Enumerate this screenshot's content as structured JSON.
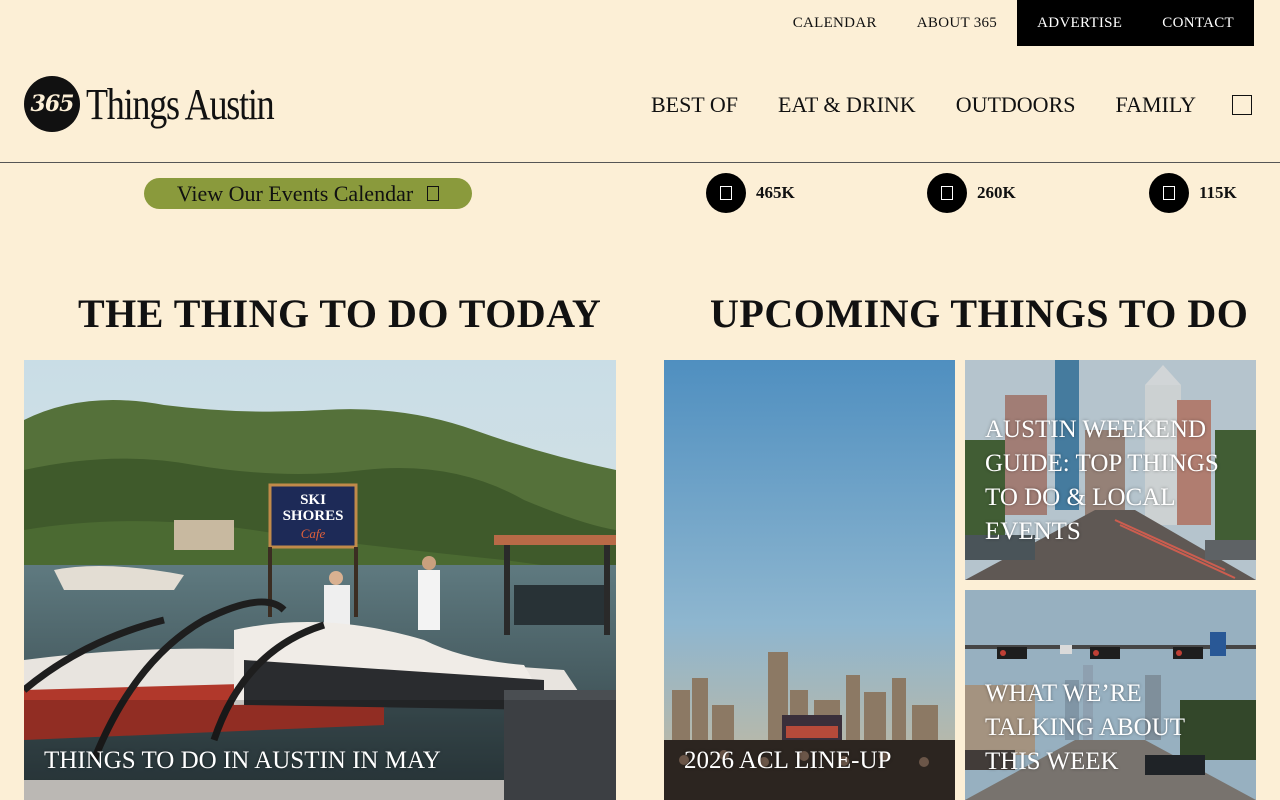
{
  "top_nav": [
    "CALENDAR",
    "ABOUT 365",
    "ADVERTISE",
    "CONTACT"
  ],
  "logo": {
    "mark": "365",
    "text": "Things Austin"
  },
  "main_nav": [
    "BEST OF",
    "EAT & DRINK",
    "OUTDOORS",
    "FAMILY"
  ],
  "events_button": "View Our Events Calendar",
  "social": [
    {
      "icon": "facebook-icon",
      "count": "465K"
    },
    {
      "icon": "instagram-icon",
      "count": "260K"
    },
    {
      "icon": "twitter-icon",
      "count": "115K"
    }
  ],
  "sections": {
    "today": "THE THING TO DO TODAY",
    "upcoming": "UPCOMING THINGS TO DO"
  },
  "cards": {
    "today": "THINGS TO DO IN AUSTIN IN MAY",
    "upcoming": [
      "2026 ACL LINE-UP",
      "AUSTIN WEEKEND GUIDE: TOP THINGS TO DO & LOCAL EVENTS",
      "WHAT WE’RE TALKING ABOUT THIS WEEK"
    ]
  },
  "photo_sign": {
    "line1": "SKI",
    "line2": "SHORES",
    "line3": "Cafe"
  }
}
